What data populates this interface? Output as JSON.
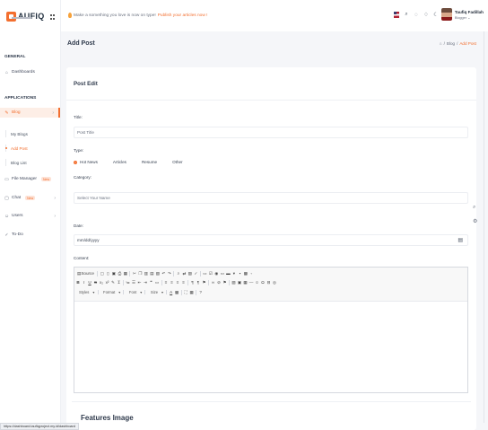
{
  "brand": {
    "name": "AUFIQ",
    "accent": "#f36f2f"
  },
  "sidebar": {
    "sections": [
      {
        "title": "GENERAL"
      },
      {
        "title": "APPLICATIONS"
      }
    ],
    "items": [
      {
        "label": "Dashboards",
        "icon": "home-icon"
      },
      {
        "label": "Blog",
        "icon": "edit-icon",
        "chevron": "›",
        "active": true
      },
      {
        "label": "File Manager",
        "icon": "file-icon",
        "badge": "New"
      },
      {
        "label": "Chat",
        "icon": "chat-icon",
        "badge": "New",
        "chevron": "›"
      },
      {
        "label": "Users",
        "icon": "users-icon",
        "chevron": "›"
      },
      {
        "label": "To-Do",
        "icon": "todo-icon"
      }
    ],
    "blog_sub": [
      {
        "label": "My Blogs"
      },
      {
        "label": "Add Post",
        "active": true
      },
      {
        "label": "Blog List"
      }
    ]
  },
  "topbar": {
    "announce_text": "Make a something you love is now on type!",
    "announce_link": "Publish your articles now !",
    "user_name": "Taufiq Fadillah",
    "user_role": "Blogger"
  },
  "header": {
    "title": "Add Post",
    "breadcrumb": [
      "Blog",
      "Add Post"
    ],
    "breadcrumb_sep": "/"
  },
  "form": {
    "card_title": "Post Edit",
    "title_label": "Title:",
    "title_placeholder": "Post Title",
    "type_label": "Type:",
    "types": [
      {
        "label": "Hot News",
        "checked": true
      },
      {
        "label": "Articles",
        "checked": false
      },
      {
        "label": "Resume",
        "checked": false
      },
      {
        "label": "Other",
        "checked": false
      }
    ],
    "category_label": "Category:",
    "category_placeholder": "Select Your Name",
    "date_label": "Date:",
    "date_placeholder": "mm/dd/yyyy",
    "content_label": "Content:",
    "editor": {
      "source_label": "Source",
      "styles_label": "Styles",
      "format_label": "Format",
      "font_label": "Font",
      "size_label": "Size"
    }
  },
  "features": {
    "title": "Features Image"
  },
  "status_url": "https://dashboard.taufiqproject.my.id/dashboard"
}
